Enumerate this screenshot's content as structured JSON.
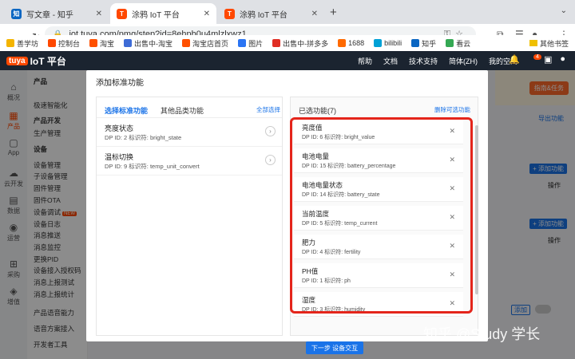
{
  "browser": {
    "tabs": [
      {
        "label": "写文章 - 知乎",
        "color": "#0a66c2",
        "glyph": "知"
      },
      {
        "label": "涂鸦 IoT 平台",
        "color": "#ff4800",
        "glyph": "T"
      },
      {
        "label": "涂鸦 IoT 平台",
        "color": "#ff4800",
        "glyph": "T"
      }
    ],
    "url": "iot.tuya.com/pmg/step?id=8ehpb0u4mlzlxwz1",
    "bookmarks": [
      {
        "label": "善学坊",
        "color": "#f4b400"
      },
      {
        "label": "控制台",
        "color": "#ff4800"
      },
      {
        "label": "淘宝",
        "color": "#ff5000"
      },
      {
        "label": "出售中-淘宝",
        "color": "#3d6bd6"
      },
      {
        "label": "淘宝店首页",
        "color": "#ff5000"
      },
      {
        "label": "图片",
        "color": "#2a74f3"
      },
      {
        "label": "出售中-拼多多",
        "color": "#e02e24"
      },
      {
        "label": "1688",
        "color": "#ff6a00"
      },
      {
        "label": "bilibili",
        "color": "#00a1d6"
      },
      {
        "label": "知乎",
        "color": "#0a66c2"
      },
      {
        "label": "看云",
        "color": "#34a853"
      }
    ],
    "other_bookmarks": "其他书签"
  },
  "app": {
    "logo": "IoT 平台",
    "logo_brand": "tuya",
    "nav": [
      "帮助",
      "文档",
      "技术支持",
      "简体(ZH)",
      "我的空间"
    ],
    "badge": "4",
    "rail": [
      {
        "label": "概况",
        "icon": "home-icon"
      },
      {
        "label": "产品",
        "icon": "product-icon"
      },
      {
        "label": "App",
        "icon": "app-icon"
      },
      {
        "label": "云开发",
        "icon": "cloud-icon"
      },
      {
        "label": "数据",
        "icon": "data-icon"
      },
      {
        "label": "运营",
        "icon": "operation-icon"
      },
      {
        "label": "采购",
        "icon": "purchase-icon"
      },
      {
        "label": "增值",
        "icon": "value-added-icon"
      }
    ],
    "menu": {
      "header": "产品",
      "items": [
        "极速智能化",
        "产品开发",
        "生产管理",
        "设备",
        "设备管理",
        "子设备管理",
        "固件管理",
        "固件OTA",
        "设备调试",
        "设备日志",
        "消息推送",
        "消息监控",
        "更换PID",
        "设备接入授权码",
        "消息上报测试",
        "消息上报统计",
        "产品语音能力",
        "语音方案接入",
        "开发者工具"
      ],
      "new_tag": "NEW"
    },
    "right_bg": {
      "guide_button": "指南&任务",
      "import_link": "导出功能",
      "add_label_1": "+ 添加功能",
      "ops_1": "操作",
      "add_label_2": "+ 添加功能",
      "ops_2": "操作",
      "add_btn": "添加"
    }
  },
  "modal": {
    "title": "添加标准功能",
    "left_tabs": [
      "选择标准功能",
      "其他品类功能"
    ],
    "select_all": "全部选择",
    "left_items": [
      {
        "title": "亮度状态",
        "sub": "DP ID: 2    标识符: bright_state"
      },
      {
        "title": "温标切换",
        "sub": "DP ID: 9    标识符: temp_unit_convert"
      }
    ],
    "right_header": "已选功能(7)",
    "clear_selected": "删除可选功能",
    "right_items": [
      {
        "title": "亮度值",
        "sub": "DP ID: 6    标识符: bright_value"
      },
      {
        "title": "电池电量",
        "sub": "DP ID: 15    标识符: battery_percentage"
      },
      {
        "title": "电池电量状态",
        "sub": "DP ID: 14    标识符: battery_state"
      },
      {
        "title": "当前温度",
        "sub": "DP ID: 5    标识符: temp_current"
      },
      {
        "title": "肥力",
        "sub": "DP ID: 4    标识符: fertility"
      },
      {
        "title": "PH值",
        "sub": "DP ID: 1    标识符: ph"
      },
      {
        "title": "湿度",
        "sub": "DP ID: 3    标识符: humidity"
      }
    ],
    "next_button": "下一步 设备交互"
  },
  "watermark": "知乎 @Study 学长",
  "colors": {
    "accent": "#1a73e8",
    "brand": "#ff4800",
    "highlight": "#e4251b"
  }
}
